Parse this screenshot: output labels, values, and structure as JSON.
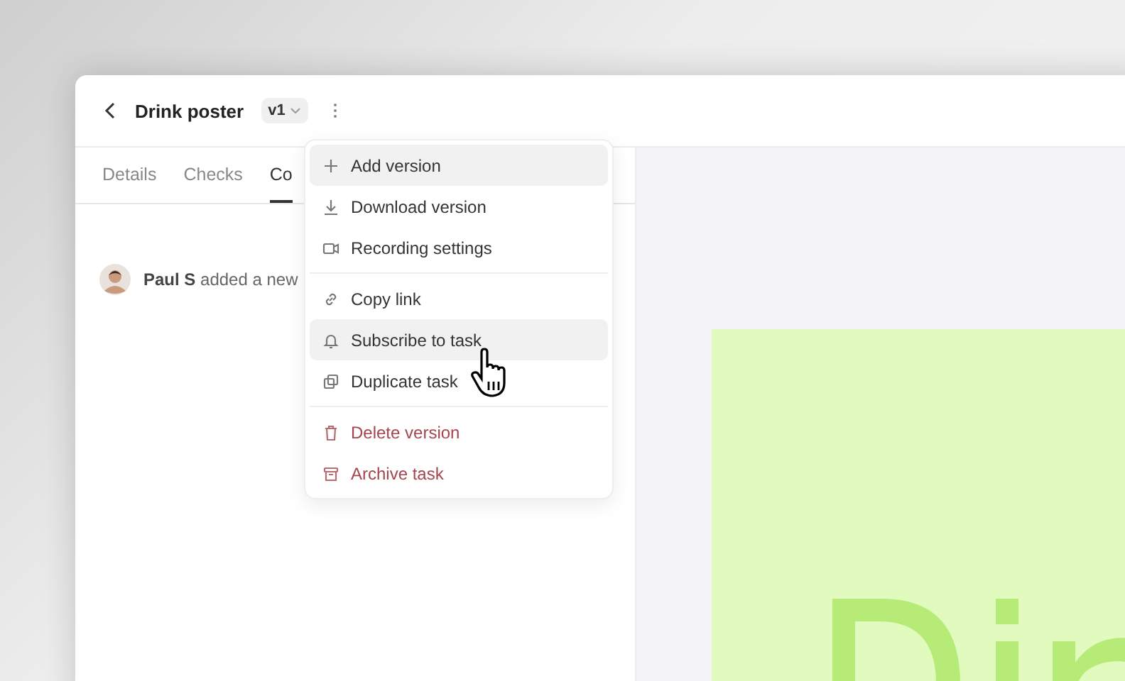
{
  "header": {
    "title": "Drink poster",
    "version": "v1"
  },
  "tabs": [
    {
      "label": "Details",
      "selected": false
    },
    {
      "label": "Checks",
      "selected": false
    },
    {
      "label": "Co",
      "selected": true
    }
  ],
  "activity": [
    {
      "author": "Paul S",
      "text": "added a new"
    }
  ],
  "menu": {
    "groups": [
      [
        {
          "label": "Add version",
          "kind": "normal",
          "highlighted": true
        },
        {
          "label": "Download version",
          "kind": "normal",
          "highlighted": false
        },
        {
          "label": "Recording settings",
          "kind": "normal",
          "highlighted": false
        }
      ],
      [
        {
          "label": "Copy link",
          "kind": "normal",
          "highlighted": false
        },
        {
          "label": "Subscribe to task",
          "kind": "normal",
          "highlighted": true
        },
        {
          "label": "Duplicate task",
          "kind": "normal",
          "highlighted": false
        }
      ],
      [
        {
          "label": "Delete version",
          "kind": "danger",
          "highlighted": false
        },
        {
          "label": "Archive task",
          "kind": "danger",
          "highlighted": false
        }
      ]
    ]
  }
}
